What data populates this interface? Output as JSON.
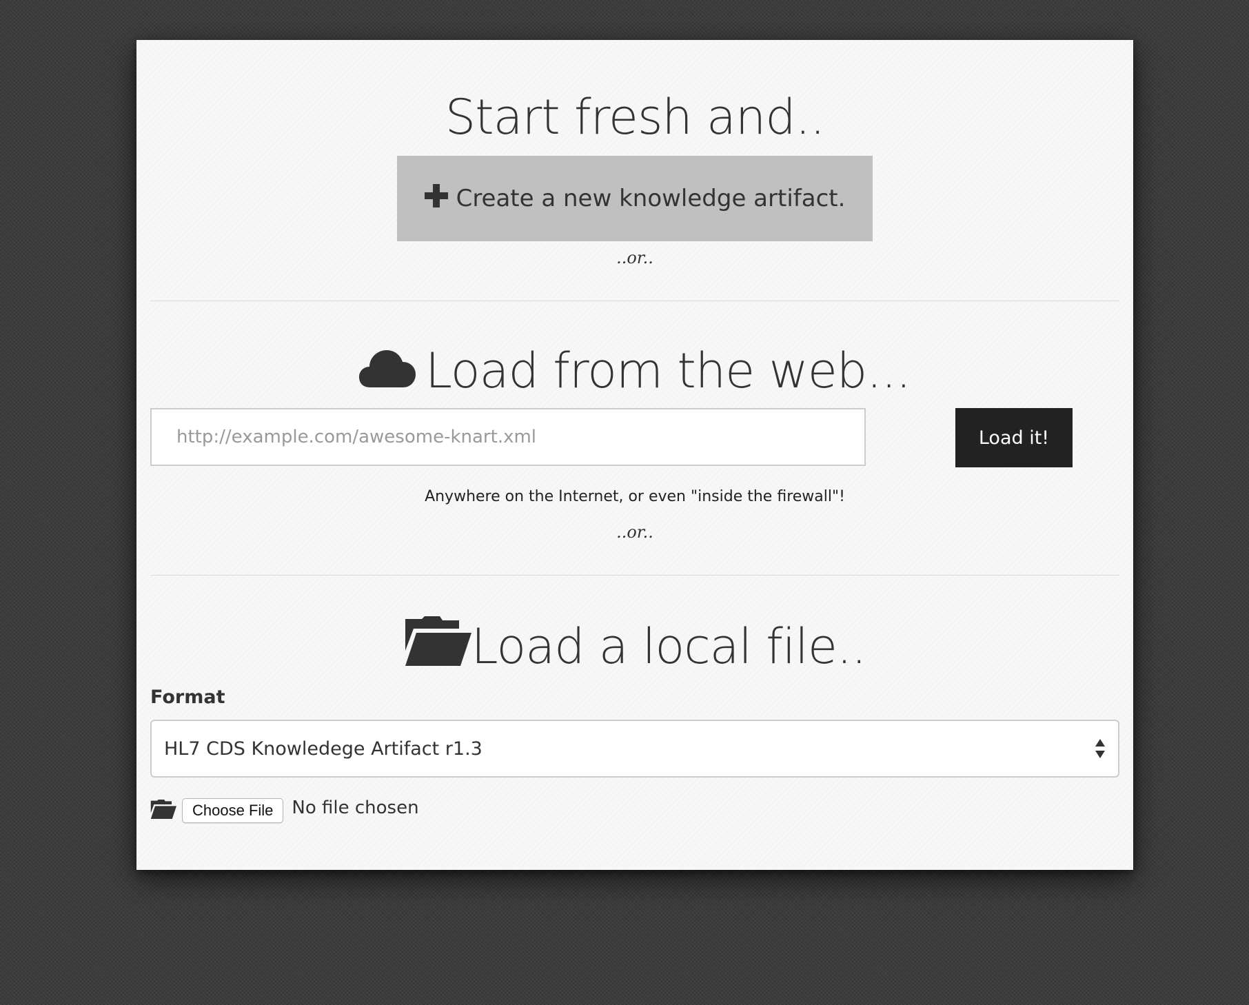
{
  "start": {
    "heading": "Start fresh and..",
    "create_button": "Create a new knowledge artifact.",
    "or_text": "..or.."
  },
  "web": {
    "heading": "Load from the web...",
    "url_placeholder": "http://example.com/awesome-knart.xml",
    "url_value": "",
    "load_button": "Load it!",
    "help_text": "Anywhere on the Internet, or even \"inside the firewall\"!",
    "or_text": "..or.."
  },
  "local": {
    "heading": "Load a local file..",
    "format_label": "Format",
    "format_selected": "HL7 CDS Knowledege Artifact r1.3",
    "choose_file_button": "Choose File",
    "file_status": "No file chosen"
  },
  "icons": {
    "create": "plus-icon",
    "web": "cloud-icon",
    "local": "folder-open-icon",
    "file": "folder-open-icon"
  },
  "colors": {
    "page_bg": "#3a3a3a",
    "card_bg": "#f8f8f8",
    "create_button_bg": "#c0c0c0",
    "load_button_bg": "#222222"
  }
}
